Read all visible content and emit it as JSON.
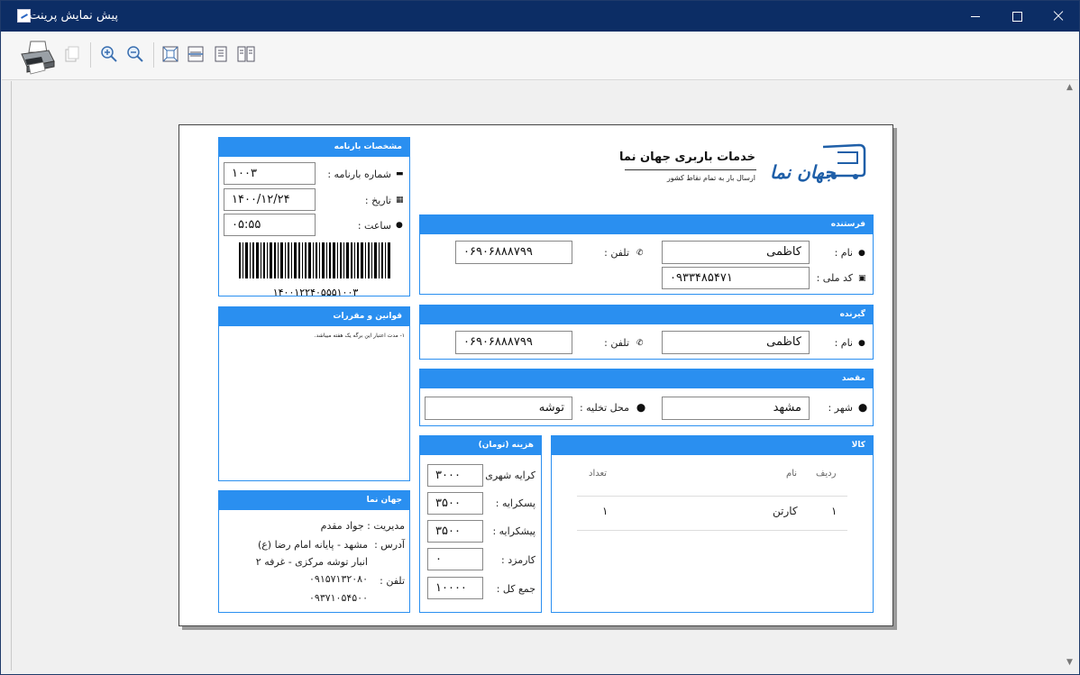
{
  "window": {
    "title": "پیش نمایش پرینت"
  },
  "toolbar": {
    "buttons": [
      "printer-icon",
      "copy-icon",
      "zoom-in-icon",
      "zoom-out-icon",
      "fit-page-icon",
      "fit-width-icon",
      "single-page-icon",
      "two-pages-icon"
    ]
  },
  "invoice": {
    "company": {
      "logo_text": "جهان نما",
      "title": "خدمات باربری جهان نما",
      "subtitle": "ارسال بار به تمام نقاط کشور"
    },
    "bill": {
      "header": "مشخصات بارنامه",
      "number_label": "شماره بارنامه :",
      "number_value": "۱۰۰۳",
      "date_label": "تاریخ :",
      "date_value": "۱۴۰۰/۱۲/۲۴",
      "time_label": "ساعت :",
      "time_value": "۰۵:۵۵",
      "barcode_text": "۱۴۰۰۱۲۲۴۰۵۵۵۱۰۰۳"
    },
    "sender": {
      "header": "فرستنده",
      "name_label": "نام :",
      "name_value": "کاظمی",
      "phone_label": "تلفن :",
      "phone_value": "۰۶۹۰۶۸۸۸۷۹۹",
      "national_id_label": "کد ملی :",
      "national_id_value": "۰۹۳۳۴۸۵۴۷۱"
    },
    "receiver": {
      "header": "گیرنده",
      "name_label": "نام :",
      "name_value": "کاظمی",
      "phone_label": "تلفن :",
      "phone_value": "۰۶۹۰۶۸۸۸۷۹۹"
    },
    "destination": {
      "header": "مقصد",
      "city_label": "شهر :",
      "city_value": "مشهد",
      "unload_label": "محل تخلیه :",
      "unload_value": "توشه"
    },
    "rules": {
      "header": "قوانین و مقررات",
      "text": "۱- مدت اعتبار این برگه یک هفته میباشد."
    },
    "cost": {
      "header": "هزینه (تومان)",
      "rows": [
        {
          "label": "کرایه شهری :",
          "value": "۳۰۰۰"
        },
        {
          "label": "پسکرایه :",
          "value": "۳۵۰۰"
        },
        {
          "label": "پیشکرایه :",
          "value": "۳۵۰۰"
        },
        {
          "label": "کارمزد :",
          "value": "۰"
        },
        {
          "label": "جمع کل :",
          "value": "۱۰۰۰۰"
        }
      ]
    },
    "goods": {
      "header": "کالا",
      "columns": [
        "ردیف",
        "نام",
        "تعداد"
      ],
      "rows": [
        {
          "row": "۱",
          "name": "کارتن",
          "qty": "۱"
        }
      ]
    },
    "footer": {
      "header": "جهان نما",
      "management": "مدیریت : جواد مقدم",
      "address_label": "آدرس :",
      "address_line1": "مشهد - پایانه امام رضا (ع)",
      "address_line2": "انبار توشه مرکزی - غرفه ۲",
      "phone_label": "تلفن :",
      "phone1": "۰۹۱۵۷۱۳۲۰۸۰",
      "phone2": "۰۹۳۷۱۰۵۴۵۰۰"
    }
  }
}
